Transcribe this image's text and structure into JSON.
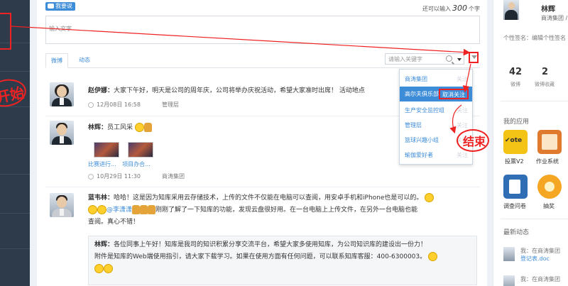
{
  "annotations": {
    "start": "开始",
    "end": "结束"
  },
  "composer": {
    "tag": "我要说",
    "remaining_prefix": "还可以输入",
    "remaining_count": "300",
    "remaining_suffix": "个字",
    "placeholder": "输入文字"
  },
  "tabs": {
    "weibo": "微博",
    "dongtai": "动态"
  },
  "search": {
    "placeholder": "请输入关键字"
  },
  "filter_menu": {
    "items": [
      {
        "label": "商涛集团",
        "action": "关注"
      },
      {
        "label": "高尔夫俱乐部",
        "action": "取消关注"
      },
      {
        "label": "生产安全监控组",
        "action": "关注"
      },
      {
        "label": "管理层",
        "action": "关注"
      },
      {
        "label": "篮球兴趣小组",
        "action": "关注"
      },
      {
        "label": "瑜伽爱好者",
        "action": "关注"
      }
    ]
  },
  "feed": [
    {
      "author": "赵伊娜：",
      "text": "大家下午好，明天是公司的周年庆，公司将举办庆祝活动，希望大家准时出席！ 活动地点",
      "date": "12月08日 16:58",
      "source": "管理层"
    },
    {
      "author": "林辉：",
      "text": "员工风采",
      "captions": [
        "比赛进行...",
        "项目办合..."
      ],
      "date": "10月29日 11:30",
      "source": "商涛集团"
    },
    {
      "author": "蓝韦林：",
      "line1": "哈哈！这是因为知库采用云存储技术，上传的文件不仅能在电脑可以查阅，用安卓手机和iPhone也是可以的。",
      "mention": "@李潇潇",
      "line2": "刚刚了解了一下知库的功能，发现云盘很好用。在一台电脑上上传文件，在另外一台电脑也能",
      "line3": "查阅。真心不错！",
      "quote": {
        "author": "林辉：",
        "line1": "各位同事上午好！知库是我司的知识积累分享交流平台，希望大家多使用知库，为公司知识库的建设出一份力！",
        "line2": "附件是知库的Web端使用指引，请大家下载学习。如果在使用方面有任何问题，可以联系知库客服：400-6300003。"
      }
    }
  ],
  "profile": {
    "name": "林辉",
    "org": "商涛集团 /",
    "signature": "个性签名：编辑个性签名",
    "stats": [
      {
        "value": "42",
        "label": "微博"
      },
      {
        "value": "2",
        "label": "微博收藏"
      }
    ]
  },
  "apps": {
    "title": "我的应用",
    "items": [
      {
        "label": "投票V2",
        "icon": "vote-icon",
        "color": "#f3c315"
      },
      {
        "label": "作业系统",
        "icon": "homework-icon",
        "color": "#e07a2e"
      },
      {
        "label": "调查问卷",
        "icon": "survey-icon",
        "color": "#2f6db5"
      },
      {
        "label": "抽奖",
        "icon": "lottery-icon",
        "color": "#f5a623"
      }
    ]
  },
  "news": {
    "title": "最新动态",
    "items": [
      {
        "text": "我：在商涛集团",
        "link": "登记表.doc"
      },
      {
        "text": "我：在商涛集团",
        "link": ""
      }
    ]
  }
}
